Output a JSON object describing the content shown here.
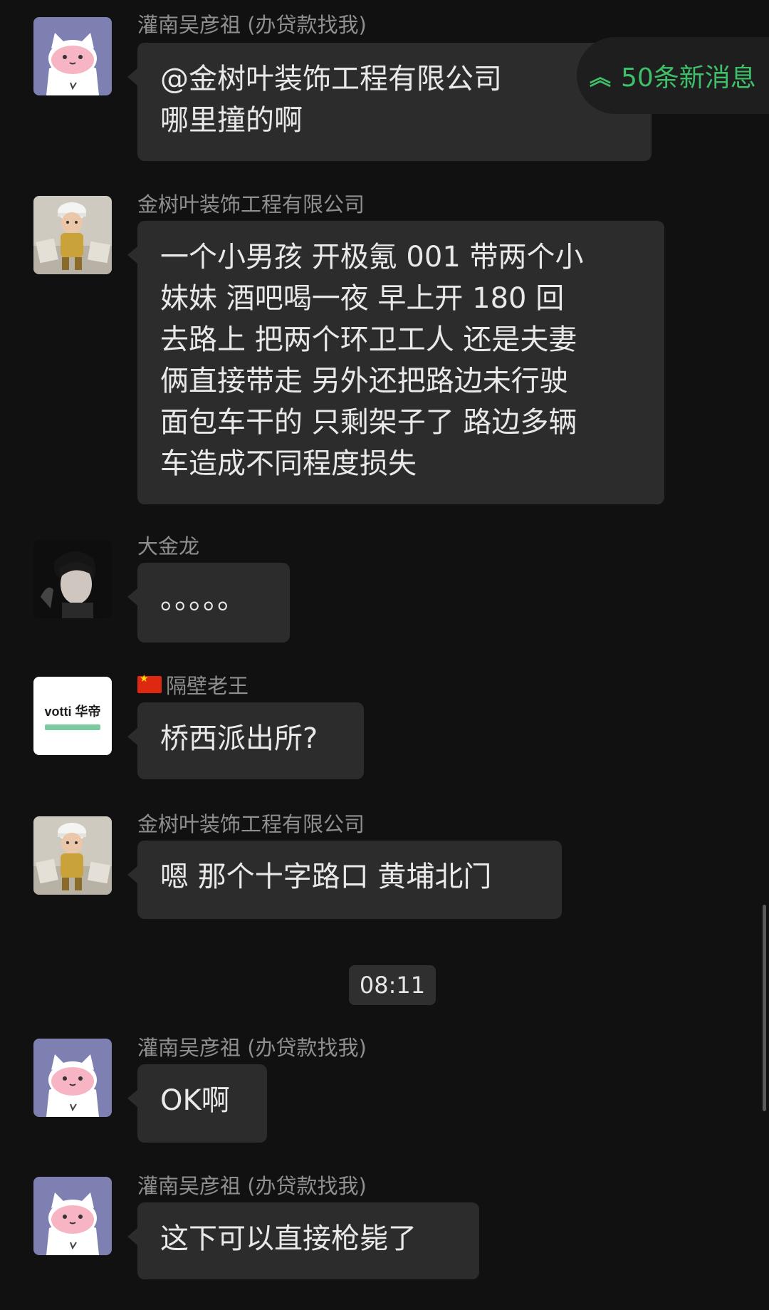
{
  "new_messages_pill": {
    "icon": "double-chevron-up-icon",
    "label": "50条新消息"
  },
  "messages": [
    {
      "sender": "灌南吴彦祖 (办贷款找我)",
      "avatar": "pink-cat-avatar",
      "lines": [
        "@金树叶装饰工程有限公司",
        "哪里撞的啊"
      ]
    },
    {
      "sender": "金树叶装饰工程有限公司",
      "avatar": "construction-figure-avatar",
      "lines": [
        " 一个小男孩 开极氪 001 带两个小",
        "妹妹  酒吧喝一夜  早上开 180 回",
        "去路上 把两个环卫工人 还是夫妻",
        "俩直接带走  另外还把路边未行驶",
        "面包车干的 只剩架子了 路边多辆",
        "车造成不同程度损失"
      ]
    },
    {
      "sender": "大金龙",
      "avatar": "person-photo-avatar",
      "lines": [
        "。。。。。"
      ]
    },
    {
      "sender": "隔壁老王",
      "sender_flag": "china-flag-icon",
      "avatar": "votti-logo-avatar",
      "avatar_text": "votti 华帝",
      "lines": [
        "桥西派出所?"
      ]
    },
    {
      "sender": "金树叶装饰工程有限公司",
      "avatar": "construction-figure-avatar",
      "lines": [
        "嗯 那个十字路口 黄埔北门"
      ]
    },
    {
      "sender": "灌南吴彦祖 (办贷款找我)",
      "avatar": "pink-cat-avatar",
      "lines": [
        "OK啊"
      ]
    },
    {
      "sender": "灌南吴彦祖 (办贷款找我)",
      "avatar": "pink-cat-avatar",
      "lines": [
        "这下可以直接枪毙了"
      ]
    }
  ],
  "timestamp": "08:11",
  "colors": {
    "background": "#111111",
    "bubble": "#2c2c2c",
    "accent_green": "#3fbf6a"
  }
}
